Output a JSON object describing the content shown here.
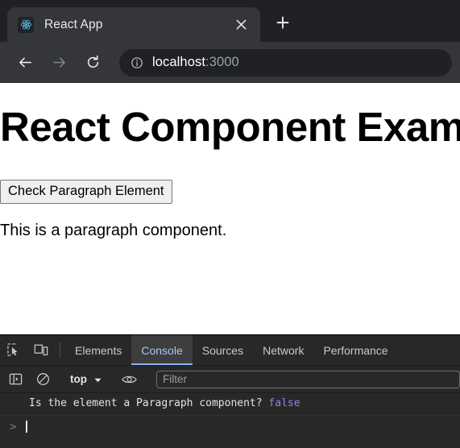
{
  "browser": {
    "tab": {
      "title": "React App",
      "favicon_icon": "react-logo-icon",
      "close_icon": "close-icon"
    },
    "new_tab_icon": "plus-icon",
    "nav": {
      "back_icon": "back-arrow-icon",
      "forward_icon": "forward-arrow-icon",
      "reload_icon": "reload-icon"
    },
    "omnibox": {
      "info_icon": "page-info-icon",
      "host": "localhost",
      "port": ":3000"
    }
  },
  "page": {
    "heading": "React Component Example",
    "button_label": "Check Paragraph Element",
    "paragraph": "This is a paragraph component."
  },
  "devtools": {
    "inspect_icon": "inspect-element-icon",
    "device_toolbar_icon": "device-toolbar-icon",
    "tabs": [
      {
        "label": "Elements",
        "active": false
      },
      {
        "label": "Console",
        "active": true
      },
      {
        "label": "Sources",
        "active": false
      },
      {
        "label": "Network",
        "active": false
      },
      {
        "label": "Performance",
        "active": false
      }
    ],
    "console_toolbar": {
      "sidebar_icon": "console-sidebar-icon",
      "clear_icon": "clear-console-icon",
      "context": "top",
      "context_caret_icon": "chevron-down-icon",
      "eye_icon": "live-expression-eye-icon",
      "filter_placeholder": "Filter"
    },
    "console": {
      "message_text": "Is the element a Paragraph component?",
      "message_value": "false",
      "prompt_symbol": ">",
      "input_value": ""
    }
  },
  "colors": {
    "chrome_bg": "#202124",
    "toolbar_bg": "#35363a",
    "devtools_bg": "#282828",
    "accent_blue": "#8ab4f8",
    "react_blue": "#61dafb",
    "boolean_purple": "#8d81ea"
  }
}
